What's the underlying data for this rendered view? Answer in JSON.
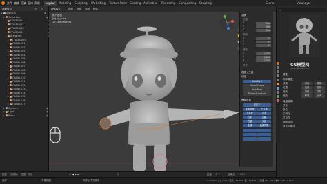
{
  "topbar": {
    "menus": [
      "文件",
      "编辑",
      "渲染",
      "窗口",
      "帮助"
    ],
    "workspaces": [
      "Layout",
      "Modeling",
      "Sculpting",
      "UV Editing",
      "Texture Paint",
      "Shading",
      "Animation",
      "Rendering",
      "Compositing",
      "Scripting"
    ],
    "active_workspace": "Layout",
    "scene_label": "Scene",
    "view_layer_label": "ViewLayer"
  },
  "outliner": {
    "title": "场景集合",
    "rows": [
      {
        "label": "场景集合",
        "indent": 0,
        "color": "#bfbfbf"
      },
      {
        "label": "Collection",
        "indent": 1,
        "color": "#e0a070"
      },
      {
        "label": "ГЛАЗА.001",
        "indent": 2,
        "color": "#e0a070"
      },
      {
        "label": "ГЛАЗА.002",
        "indent": 2,
        "color": "#e0a070"
      },
      {
        "label": "ГЛАЗА.003",
        "indent": 2,
        "color": "#e0a070"
      },
      {
        "label": "ГЛАЗА.004",
        "indent": 2,
        "color": "#e0a070"
      },
      {
        "label": "Armature",
        "indent": 2,
        "color": "#d6b26a"
      },
      {
        "label": "ГЛАЗА.005",
        "indent": 3,
        "color": "#e0a070"
      },
      {
        "label": "ЛАПЫ.001",
        "indent": 3,
        "color": "#e0a070"
      },
      {
        "label": "ЛАПЫ.002",
        "indent": 3,
        "color": "#e0a070"
      },
      {
        "label": "ЛАПЫ.003",
        "indent": 3,
        "color": "#e0a070"
      },
      {
        "label": "ЛАПЫ.004",
        "indent": 3,
        "color": "#e0a070"
      },
      {
        "label": "ЛАПЫ.005",
        "indent": 3,
        "color": "#e0a070"
      },
      {
        "label": "ЛАПЫ.006",
        "indent": 3,
        "color": "#e0a070"
      },
      {
        "label": "ЛАПЫ.007",
        "indent": 3,
        "color": "#e0a070"
      },
      {
        "label": "ЛАПЫ.008",
        "indent": 3,
        "color": "#e0a070"
      },
      {
        "label": "ЛАПЫ.009",
        "indent": 3,
        "color": "#e0a070"
      },
      {
        "label": "ЛАПЫ.010",
        "indent": 3,
        "color": "#e0a070"
      },
      {
        "label": "ЛАПЫ.011",
        "indent": 3,
        "color": "#e0a070"
      },
      {
        "label": "ЛАПЫ.012",
        "indent": 3,
        "color": "#e0a070"
      },
      {
        "label": "ЛАПЫ.013",
        "indent": 3,
        "color": "#e0a070"
      },
      {
        "label": "ЛАПЫ.014",
        "indent": 3,
        "color": "#e0a070"
      },
      {
        "label": "ЛАПЫ.015",
        "indent": 3,
        "color": "#e0a070"
      },
      {
        "label": "ЛАПЫ.016",
        "indent": 3,
        "color": "#e0a070"
      },
      {
        "label": "ЛАПЫ.017",
        "indent": 3,
        "color": "#e0a070"
      },
      {
        "label": "Camera",
        "indent": 1,
        "color": "#8fb0d6"
      },
      {
        "label": "Light",
        "indent": 1,
        "color": "#d6d06a"
      },
      {
        "label": "Plane",
        "indent": 1,
        "color": "#e0a070"
      }
    ]
  },
  "viewport": {
    "header_items": [
      "物体模式",
      "视图",
      "选择",
      "添加",
      "物体"
    ],
    "info_lines": [
      "用户透视",
      "(0) ry_cube",
      "10 Centimeters"
    ],
    "axis_labels": [
      "X",
      "Y",
      "Z"
    ]
  },
  "npanel": {
    "transform_title": "变换",
    "location_label": "位置",
    "rotation_label": "旋转",
    "scale_label": "缩放",
    "dims_label": "尺寸",
    "fields": [
      {
        "label": "X",
        "value": "0 m"
      },
      {
        "label": "Y",
        "value": "0 m"
      },
      {
        "label": "Z",
        "value": "0 m"
      },
      {
        "label": "X",
        "value": "0°"
      },
      {
        "label": "Y",
        "value": "0°"
      },
      {
        "label": "Z",
        "value": "0°"
      },
      {
        "label": "X",
        "value": "1.000"
      },
      {
        "label": "Y",
        "value": "1.000"
      },
      {
        "label": "Z",
        "value": "1.000"
      }
    ],
    "section2_title": "视图 / 工具",
    "section3_title": "动画",
    "buttons": [
      "BlenRig 5",
      "Mixed Shape",
      "Rest Pose",
      "Picker Armature",
      "自定义",
      "重置骨骼",
      "上半身",
      "下半身",
      "左手",
      "右手",
      "左腿",
      "右腿",
      "头部",
      "全部",
      "选择骨骼"
    ],
    "section4_title": "骨架设置"
  },
  "right_sidebar": {
    "watermark": "CG模型网",
    "sub_watermark": "www.cgmodel.com",
    "props_title": "属性",
    "rows": [
      "物体属性",
      "变换",
      "位置",
      "旋转",
      "缩放",
      "增量变换",
      "关系",
      "集合",
      "实例化",
      "可见性",
      "视图显示",
      "自定义属性"
    ],
    "buttons": [
      "添加",
      "移除",
      "应用",
      "复制",
      "重置",
      "清除",
      "移动",
      "对齐"
    ]
  },
  "timeline": {
    "items": [
      "回放",
      "关键帧",
      "视图",
      "标记"
    ],
    "start_label": "起始",
    "start_value": "1",
    "end_label": "结束点",
    "end_value": "250",
    "current_frame": "0"
  },
  "statusbar": {
    "left": "选择",
    "middle": "平移视图",
    "right_menu": "物体上下文菜单",
    "stats": "Collection | ry_cube | 顶点 131,654 | 面 130,836 | 三角面 261,672 | 物体 1/38 | 2.93.0"
  },
  "colors": {
    "accent_blue": "#3b5f94",
    "viewport_bg": "#3b3b3b",
    "orange_select": "#e07b2a"
  }
}
